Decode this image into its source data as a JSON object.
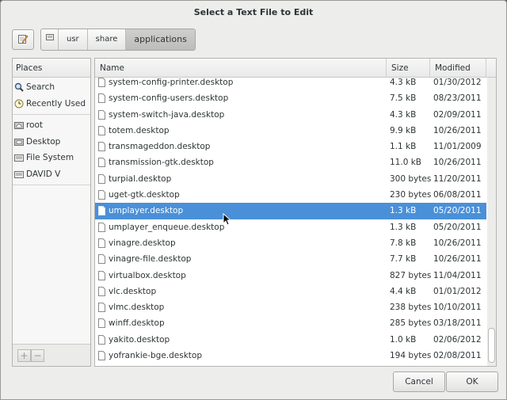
{
  "dialog": {
    "title": "Select a Text File to Edit"
  },
  "pathbar": {
    "crumbs": [
      "usr",
      "share",
      "applications"
    ]
  },
  "places": {
    "header": "Places",
    "items": [
      {
        "label": "Search",
        "icon": "search-icon"
      },
      {
        "label": "Recently Used",
        "icon": "recent-icon"
      },
      {
        "label": "root",
        "icon": "home-folder-icon"
      },
      {
        "label": "Desktop",
        "icon": "desktop-folder-icon"
      },
      {
        "label": "File System",
        "icon": "drive-icon"
      },
      {
        "label": "DAVID V",
        "icon": "drive-icon"
      }
    ],
    "add_label": "+",
    "remove_label": "−"
  },
  "files": {
    "columns": {
      "name": "Name",
      "size": "Size",
      "modified": "Modified"
    },
    "rows": [
      {
        "name": "system-config-printer.desktop",
        "size": "4.3 kB",
        "modified": "01/30/2012"
      },
      {
        "name": "system-config-users.desktop",
        "size": "7.5 kB",
        "modified": "08/23/2011"
      },
      {
        "name": "system-switch-java.desktop",
        "size": "4.3 kB",
        "modified": "02/09/2011"
      },
      {
        "name": "totem.desktop",
        "size": "9.9 kB",
        "modified": "10/26/2011"
      },
      {
        "name": "transmageddon.desktop",
        "size": "1.1 kB",
        "modified": "11/01/2009"
      },
      {
        "name": "transmission-gtk.desktop",
        "size": "11.0 kB",
        "modified": "10/26/2011"
      },
      {
        "name": "turpial.desktop",
        "size": "300 bytes",
        "modified": "11/20/2011"
      },
      {
        "name": "uget-gtk.desktop",
        "size": "230 bytes",
        "modified": "06/08/2011"
      },
      {
        "name": "umplayer.desktop",
        "size": "1.3 kB",
        "modified": "05/20/2011"
      },
      {
        "name": "umplayer_enqueue.desktop",
        "size": "1.3 kB",
        "modified": "05/20/2011"
      },
      {
        "name": "vinagre.desktop",
        "size": "7.8 kB",
        "modified": "10/26/2011"
      },
      {
        "name": "vinagre-file.desktop",
        "size": "7.7 kB",
        "modified": "10/26/2011"
      },
      {
        "name": "virtualbox.desktop",
        "size": "827 bytes",
        "modified": "11/04/2011"
      },
      {
        "name": "vlc.desktop",
        "size": "4.4 kB",
        "modified": "01/01/2012"
      },
      {
        "name": "vlmc.desktop",
        "size": "238 bytes",
        "modified": "10/10/2011"
      },
      {
        "name": "winff.desktop",
        "size": "285 bytes",
        "modified": "03/18/2011"
      },
      {
        "name": "yakito.desktop",
        "size": "1.0 kB",
        "modified": "02/06/2012"
      },
      {
        "name": "yofrankie-bge.desktop",
        "size": "194 bytes",
        "modified": "02/08/2011"
      }
    ],
    "selected_index": 8
  },
  "buttons": {
    "cancel": "Cancel",
    "ok": "OK"
  },
  "colors": {
    "selection": "#4a90d9",
    "window_bg": "#ededec"
  }
}
